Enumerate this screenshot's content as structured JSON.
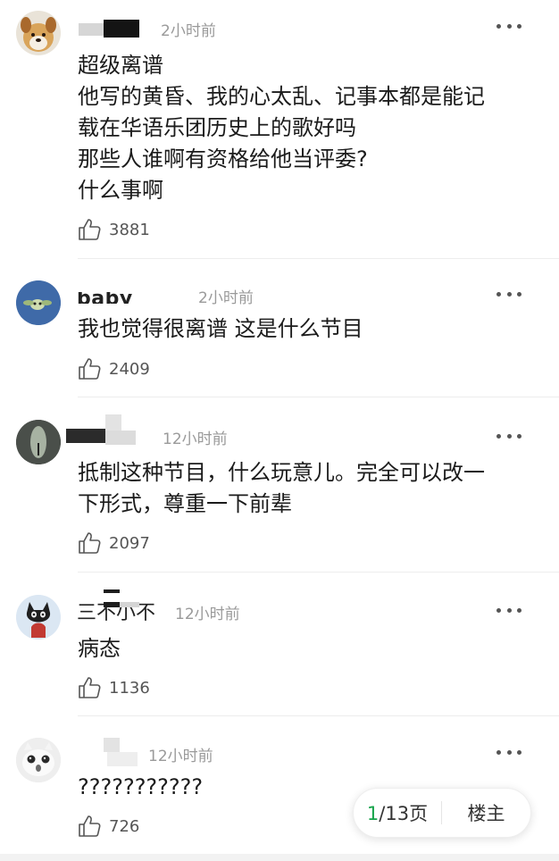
{
  "colors": {
    "accent": "#16a34a",
    "time": "#9a9a9a",
    "text": "#1b1b1b"
  },
  "comments": [
    {
      "username": "",
      "time": "2小时前",
      "text": "超级离谱\n他写的黄昏、我的心太乱、记事本都是能记\n载在华语乐团历史上的歌好吗\n那些人谁啊有资格给他当评委?\n什么事啊",
      "likes": "3881"
    },
    {
      "username": "baby yoda",
      "time": "2小时前",
      "text": "我也觉得很离谱 这是什么节目",
      "likes": "2409"
    },
    {
      "username": "",
      "time": "12小时前",
      "text": "抵制这种节目，什么玩意儿。完全可以改一\n下形式，尊重一下前辈",
      "likes": "2097"
    },
    {
      "username": "三不小不",
      "time": "12小时前",
      "text": "病态",
      "likes": "1136"
    },
    {
      "username": "",
      "time": "12小时前",
      "text": "???????????",
      "likes": "726"
    }
  ],
  "pager": {
    "current": "1",
    "total_label": "/13页",
    "owner_label": "楼主"
  },
  "icons": {
    "more": "more-dots-icon",
    "like": "thumbs-up-icon"
  }
}
